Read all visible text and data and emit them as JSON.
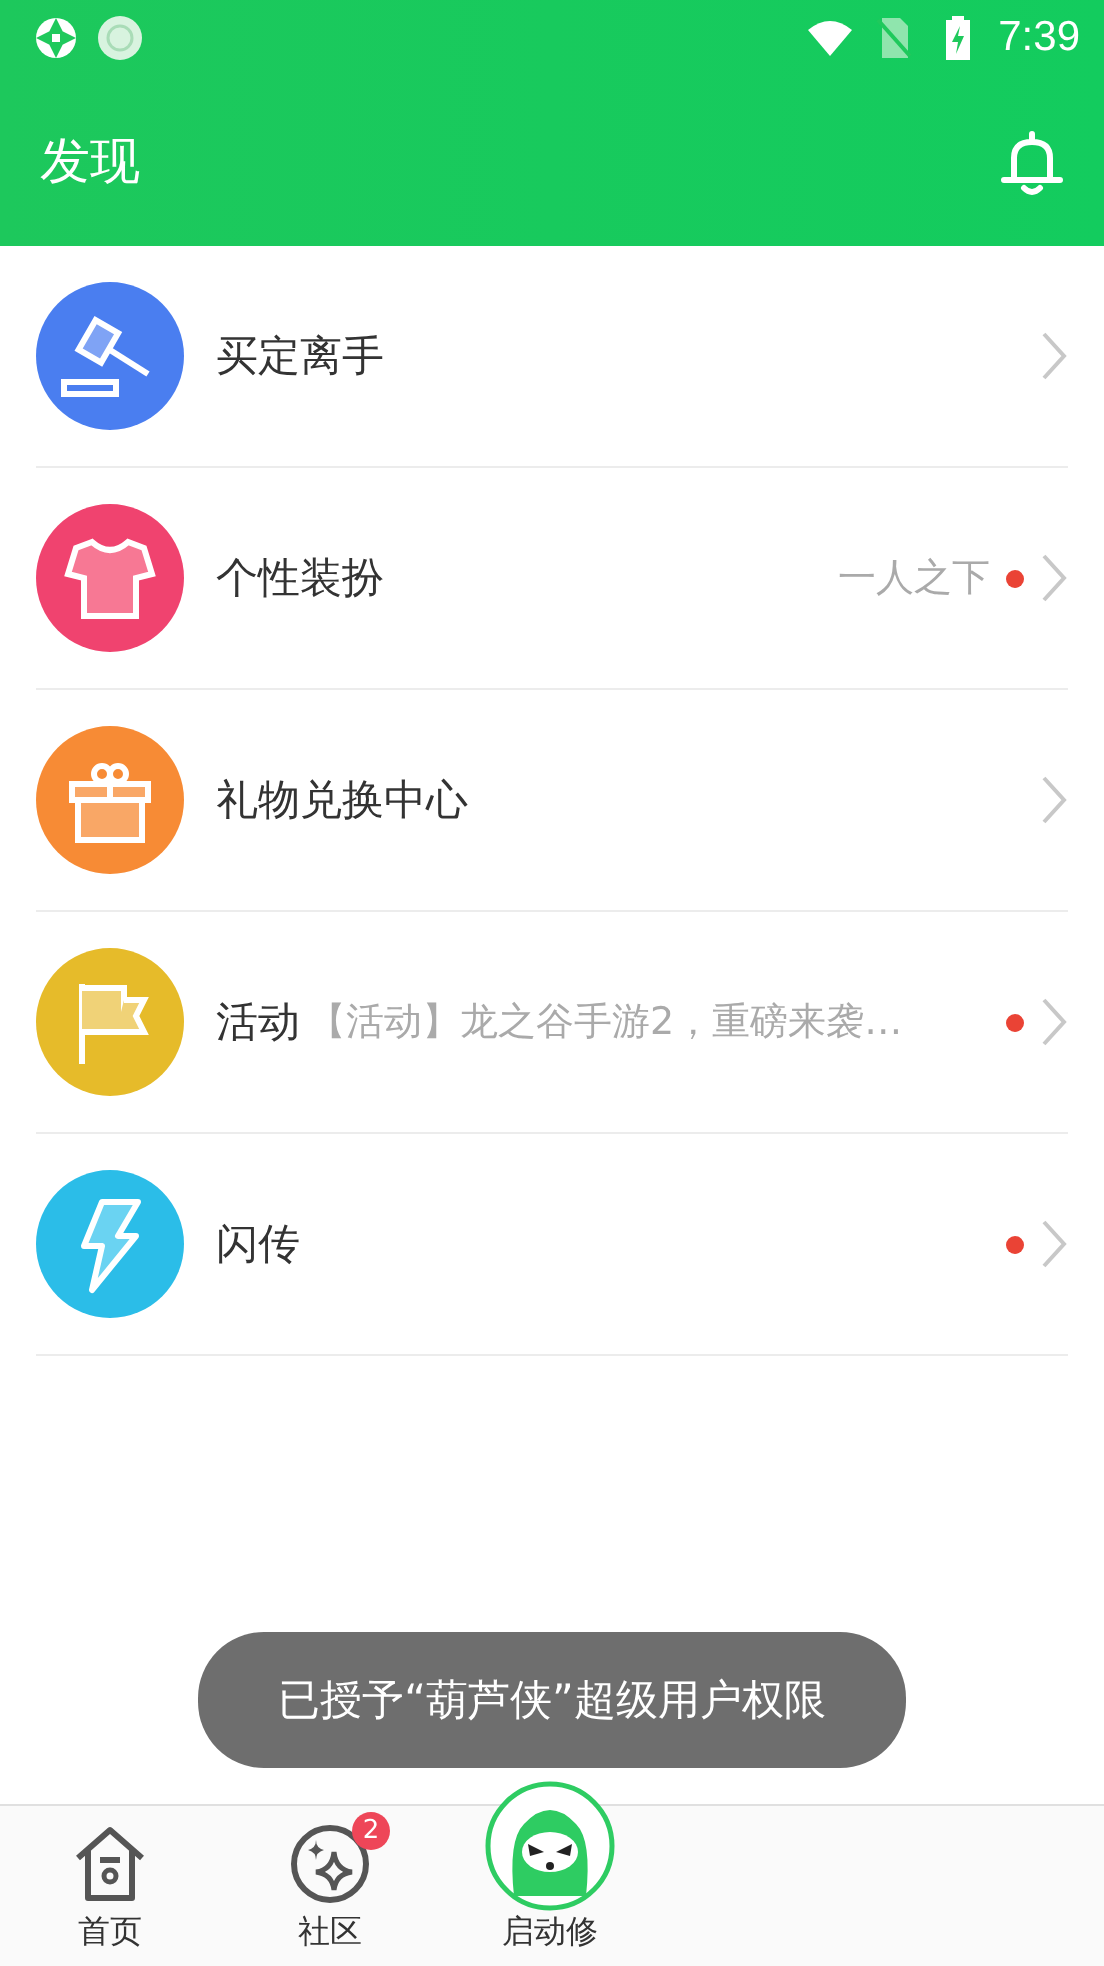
{
  "status_bar": {
    "time": "7:39"
  },
  "app_bar": {
    "title": "发现"
  },
  "items": [
    {
      "kind": "gavel",
      "title": "买定离手",
      "color": "#4a7ef0",
      "dot": false
    },
    {
      "kind": "shirt",
      "title": "个性装扮",
      "color": "#f0436f",
      "subtitle": "一人之下",
      "dot": true
    },
    {
      "kind": "gift",
      "title": "礼物兑换中心",
      "color": "#f78b35",
      "dot": false
    },
    {
      "kind": "flag",
      "title": "活动",
      "color": "#e6bb2a",
      "subtitle": "【活动】龙之谷手游2，重磅来袭…",
      "dot": true
    },
    {
      "kind": "bolt",
      "title": "闪传",
      "color": "#2bbde8",
      "dot": true
    }
  ],
  "toast": "已授予“葫芦侠”超级用户权限",
  "bottom_nav": [
    {
      "kind": "home",
      "label": "首页"
    },
    {
      "kind": "community",
      "label": "社区",
      "badge": "2"
    },
    {
      "kind": "launch",
      "label": "启动修"
    }
  ]
}
